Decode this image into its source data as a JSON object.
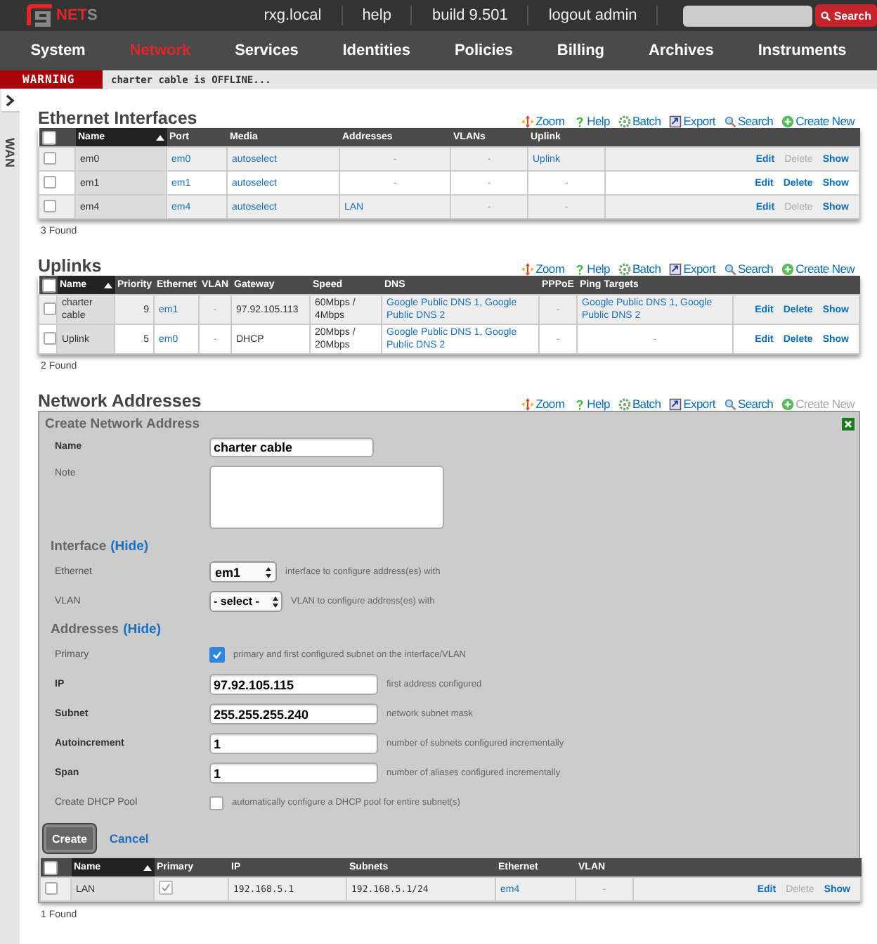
{
  "header": {
    "logo": {
      "text": "NET",
      "suffix": "S"
    },
    "links": [
      "rxg.local",
      "help",
      "build 9.501",
      "logout admin"
    ],
    "search_button": "Search"
  },
  "nav": [
    {
      "label": "System",
      "selected": false
    },
    {
      "label": "Network",
      "selected": true
    },
    {
      "label": "Services",
      "selected": false
    },
    {
      "label": "Identities",
      "selected": false
    },
    {
      "label": "Policies",
      "selected": false
    },
    {
      "label": "Billing",
      "selected": false
    },
    {
      "label": "Archives",
      "selected": false
    },
    {
      "label": "Instruments",
      "selected": false
    }
  ],
  "warning": {
    "label": "WARNING",
    "message": "charter cable is OFFLINE..."
  },
  "sidebar": {
    "label": "WAN"
  },
  "sections": [
    {
      "title": "Ethernet Interfaces",
      "toolbar": [
        {
          "kind": "zoom",
          "label": "Zoom",
          "disabled": false
        },
        {
          "kind": "help",
          "label": "Help",
          "disabled": false
        },
        {
          "kind": "batch",
          "label": "Batch",
          "disabled": false
        },
        {
          "kind": "export",
          "label": "Export",
          "disabled": false
        },
        {
          "kind": "search",
          "label": "Search",
          "disabled": false
        },
        {
          "kind": "create",
          "label": "Create New",
          "disabled": false
        }
      ],
      "table": {
        "select_all": false,
        "columns": [
          {
            "label": "Name",
            "sorted": true
          },
          {
            "label": "Port",
            "sorted": false
          },
          {
            "label": "Media",
            "sorted": false
          },
          {
            "label": "Addresses",
            "sorted": false
          },
          {
            "label": "VLANs",
            "sorted": false
          },
          {
            "label": "Uplink",
            "sorted": false
          }
        ],
        "rows": [
          {
            "checked": false,
            "cells": [
              {
                "kind": "name",
                "text": "em0"
              },
              {
                "kind": "link",
                "text": "em0"
              },
              {
                "kind": "link",
                "text": "autoselect"
              },
              {
                "kind": "dash",
                "text": "-"
              },
              {
                "kind": "dash",
                "text": "-"
              },
              {
                "kind": "link",
                "text": "Uplink"
              }
            ],
            "actions": [
              {
                "label": "Edit",
                "disabled": false
              },
              {
                "label": "Delete",
                "disabled": true
              },
              {
                "label": "Show",
                "disabled": false
              }
            ]
          },
          {
            "checked": false,
            "cells": [
              {
                "kind": "name",
                "text": "em1"
              },
              {
                "kind": "link",
                "text": "em1"
              },
              {
                "kind": "link",
                "text": "autoselect"
              },
              {
                "kind": "dash",
                "text": "-"
              },
              {
                "kind": "dash",
                "text": "-"
              },
              {
                "kind": "dash",
                "text": "-"
              }
            ],
            "actions": [
              {
                "label": "Edit",
                "disabled": false
              },
              {
                "label": "Delete",
                "disabled": false
              },
              {
                "label": "Show",
                "disabled": false
              }
            ]
          },
          {
            "checked": false,
            "cells": [
              {
                "kind": "name",
                "text": "em4"
              },
              {
                "kind": "link",
                "text": "em4"
              },
              {
                "kind": "link",
                "text": "autoselect"
              },
              {
                "kind": "link",
                "text": "LAN"
              },
              {
                "kind": "dash",
                "text": "-"
              },
              {
                "kind": "dash",
                "text": "-"
              }
            ],
            "actions": [
              {
                "label": "Edit",
                "disabled": false
              },
              {
                "label": "Delete",
                "disabled": true
              },
              {
                "label": "Show",
                "disabled": false
              }
            ]
          }
        ]
      },
      "found": "3 Found"
    },
    {
      "title": "Uplinks",
      "toolbar": [
        {
          "kind": "zoom",
          "label": "Zoom",
          "disabled": false
        },
        {
          "kind": "help",
          "label": "Help",
          "disabled": false
        },
        {
          "kind": "batch",
          "label": "Batch",
          "disabled": false
        },
        {
          "kind": "export",
          "label": "Export",
          "disabled": false
        },
        {
          "kind": "search",
          "label": "Search",
          "disabled": false
        },
        {
          "kind": "create",
          "label": "Create New",
          "disabled": false
        }
      ],
      "table": {
        "select_all": false,
        "columns": [
          {
            "label": "Name",
            "sorted": true
          },
          {
            "label": "Priority",
            "sorted": false
          },
          {
            "label": "Ethernet",
            "sorted": false
          },
          {
            "label": "VLAN",
            "sorted": false
          },
          {
            "label": "Gateway",
            "sorted": false
          },
          {
            "label": "Speed",
            "sorted": false
          },
          {
            "label": "DNS",
            "sorted": false
          },
          {
            "label": "PPPoE",
            "sorted": false
          },
          {
            "label": "Ping Targets",
            "sorted": false
          }
        ],
        "rows": [
          {
            "checked": false,
            "cells": [
              {
                "kind": "name",
                "text": "charter cable"
              },
              {
                "kind": "num",
                "text": "9"
              },
              {
                "kind": "link",
                "text": "em1"
              },
              {
                "kind": "dash",
                "text": "-"
              },
              {
                "kind": "text",
                "text": "97.92.105.113"
              },
              {
                "kind": "text",
                "text": "60Mbps / 4Mbps"
              },
              {
                "kind": "link",
                "text": "Google Public DNS 1, Google Public DNS 2"
              },
              {
                "kind": "dash",
                "text": "-"
              },
              {
                "kind": "link",
                "text": "Google Public DNS 1, Google Public DNS 2"
              }
            ],
            "actions": [
              {
                "label": "Edit",
                "disabled": false
              },
              {
                "label": "Delete",
                "disabled": false
              },
              {
                "label": "Show",
                "disabled": false
              }
            ]
          },
          {
            "checked": false,
            "cells": [
              {
                "kind": "name",
                "text": "Uplink"
              },
              {
                "kind": "num",
                "text": "5"
              },
              {
                "kind": "link",
                "text": "em0"
              },
              {
                "kind": "dash",
                "text": "-"
              },
              {
                "kind": "text",
                "text": "DHCP"
              },
              {
                "kind": "text",
                "text": "20Mbps / 20Mbps"
              },
              {
                "kind": "link",
                "text": "Google Public DNS 1, Google Public DNS 2"
              },
              {
                "kind": "dash",
                "text": "-"
              },
              {
                "kind": "dash",
                "text": "-"
              }
            ],
            "actions": [
              {
                "label": "Edit",
                "disabled": false
              },
              {
                "label": "Delete",
                "disabled": false
              },
              {
                "label": "Show",
                "disabled": false
              }
            ]
          }
        ]
      },
      "found": "2 Found"
    },
    {
      "title": "Network Addresses",
      "toolbar": [
        {
          "kind": "zoom",
          "label": "Zoom",
          "disabled": false
        },
        {
          "kind": "help",
          "label": "Help",
          "disabled": false
        },
        {
          "kind": "batch",
          "label": "Batch",
          "disabled": false
        },
        {
          "kind": "export",
          "label": "Export",
          "disabled": false
        },
        {
          "kind": "search",
          "label": "Search",
          "disabled": false
        },
        {
          "kind": "create",
          "label": "Create New",
          "disabled": true
        }
      ],
      "form": {
        "title": "Create Network Address",
        "fields": [
          {
            "kind": "text",
            "label": "Name",
            "bold": true,
            "value": "charter cable"
          },
          {
            "kind": "textarea",
            "label": "Note",
            "bold": false
          },
          {
            "kind": "heading",
            "label": "Interface",
            "link": "(Hide)"
          },
          {
            "kind": "select",
            "label": "Ethernet",
            "bold": false,
            "value": "em1",
            "hint": "interface to configure address(es) with"
          },
          {
            "kind": "select",
            "label": "VLAN",
            "bold": false,
            "value": "- select -",
            "hint": "VLAN to configure address(es) with"
          },
          {
            "kind": "heading",
            "label": "Addresses",
            "link": "(Hide)"
          },
          {
            "kind": "checkbox",
            "label": "Primary",
            "bold": false,
            "checked": true,
            "hint": "primary and first configured subnet on the interface/VLAN"
          },
          {
            "kind": "text",
            "label": "IP",
            "bold": true,
            "value": "97.92.105.115",
            "hint": "first address configured"
          },
          {
            "kind": "text",
            "label": "Subnet",
            "bold": true,
            "value": "255.255.255.240",
            "hint": "network subnet mask"
          },
          {
            "kind": "text",
            "label": "Autoincrement",
            "bold": true,
            "value": "1",
            "hint": "number of subnets configured incrementally"
          },
          {
            "kind": "text",
            "label": "Span",
            "bold": true,
            "value": "1",
            "hint": "number of aliases configured incrementally"
          },
          {
            "kind": "checkbox",
            "label": "Create DHCP Pool",
            "bold": false,
            "checked": false,
            "hint": "automatically configure a DHCP pool for entire subnet(s)"
          }
        ],
        "submit": "Create",
        "cancel": "Cancel"
      },
      "table": {
        "select_all": false,
        "columns": [
          {
            "label": "Name",
            "sorted": true
          },
          {
            "label": "Primary",
            "sorted": false
          },
          {
            "label": "IP",
            "sorted": false
          },
          {
            "label": "Subnets",
            "sorted": false
          },
          {
            "label": "Ethernet",
            "sorted": false
          },
          {
            "label": "VLAN",
            "sorted": false
          }
        ],
        "rows": [
          {
            "checked": false,
            "cells": [
              {
                "kind": "name",
                "text": "LAN"
              },
              {
                "kind": "check",
                "checked": true
              },
              {
                "kind": "mono",
                "text": "192.168.5.1"
              },
              {
                "kind": "mono",
                "text": "192.168.5.1/24"
              },
              {
                "kind": "link",
                "text": "em4"
              },
              {
                "kind": "dash",
                "text": "-"
              }
            ],
            "actions": [
              {
                "label": "Edit",
                "disabled": false
              },
              {
                "label": "Delete",
                "disabled": true
              },
              {
                "label": "Show",
                "disabled": false
              }
            ]
          }
        ]
      },
      "found": "1 Found"
    }
  ]
}
